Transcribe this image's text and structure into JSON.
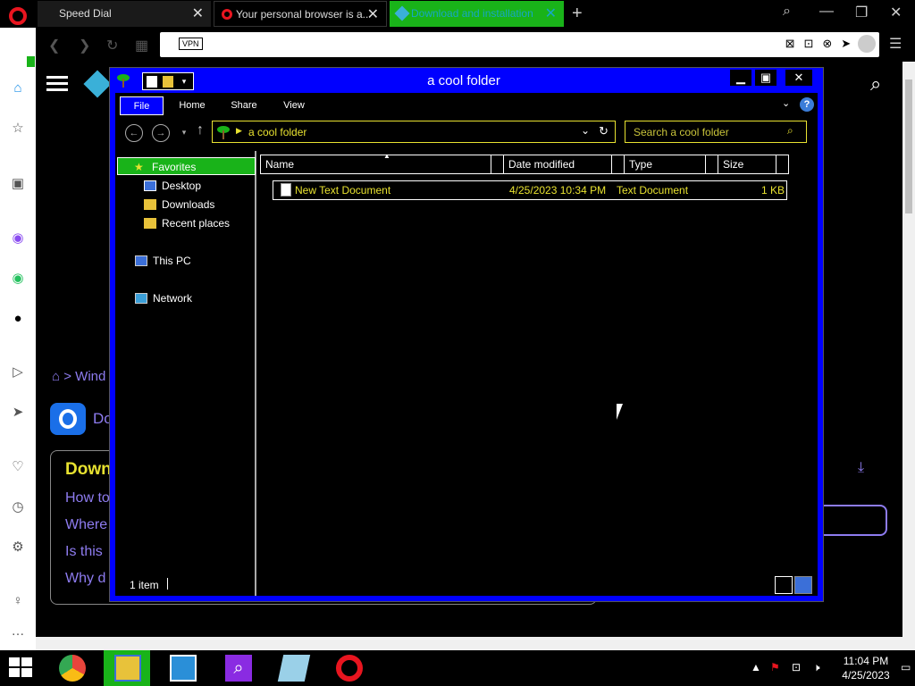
{
  "browser": {
    "tabs": [
      {
        "label": "Speed Dial"
      },
      {
        "label": "Your personal browser is a..."
      },
      {
        "label": "Download and installation"
      }
    ],
    "address": {
      "vpn_label": "VPN"
    }
  },
  "webpage": {
    "breadcrumb": "Wind",
    "app_name": "Do",
    "faq": {
      "title": "Down",
      "questions": [
        "How to",
        "Where",
        "Is this",
        "Why d"
      ]
    }
  },
  "explorer": {
    "title": "a cool folder",
    "ribbon_tabs": [
      "File",
      "Home",
      "Share",
      "View"
    ],
    "address_path": "a cool folder",
    "search_placeholder": "Search a cool folder",
    "nav": {
      "favorites": "Favorites",
      "favorites_children": [
        "Desktop",
        "Downloads",
        "Recent places"
      ],
      "this_pc": "This PC",
      "network": "Network"
    },
    "columns": [
      "Name",
      "Date modified",
      "Type",
      "Size"
    ],
    "files": [
      {
        "name": "New Text Document",
        "date": "4/25/2023 10:34 PM",
        "type": "Text Document",
        "size": "1 KB"
      }
    ],
    "status": "1 item"
  },
  "taskbar": {
    "apps": [
      "chrome-icon",
      "file-explorer-icon",
      "photos-icon",
      "search-magnifier-icon",
      "notepad-icon",
      "opera-icon"
    ],
    "clock_time": "11:04 PM",
    "clock_date": "4/25/2023"
  },
  "colors": {
    "window_frame": "#0000ff",
    "highlight": "#e8e230",
    "selected_tab": "#19b319",
    "link_purple": "#8e7cf0"
  }
}
